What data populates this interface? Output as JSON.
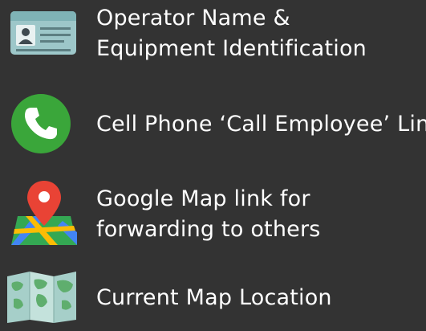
{
  "items": [
    {
      "icon": "id-card-icon",
      "lines": [
        "Operator Name &",
        "Equipment Identification"
      ]
    },
    {
      "icon": "phone-icon",
      "lines": [
        "Cell Phone ‘Call Employee’ Link"
      ]
    },
    {
      "icon": "map-pin-icon",
      "lines": [
        "Google Map link for",
        "forwarding to others"
      ]
    },
    {
      "icon": "folded-map-icon",
      "lines": [
        "Current Map Location"
      ]
    }
  ],
  "colors": {
    "background": "#333333",
    "text": "#ffffff",
    "phone_green": "#3aa63a",
    "pin_red": "#e94335",
    "map_green": "#34a853",
    "map_blue": "#4285f4",
    "map_yellow": "#fbbc05",
    "card_teal": "#9dc7c9"
  }
}
